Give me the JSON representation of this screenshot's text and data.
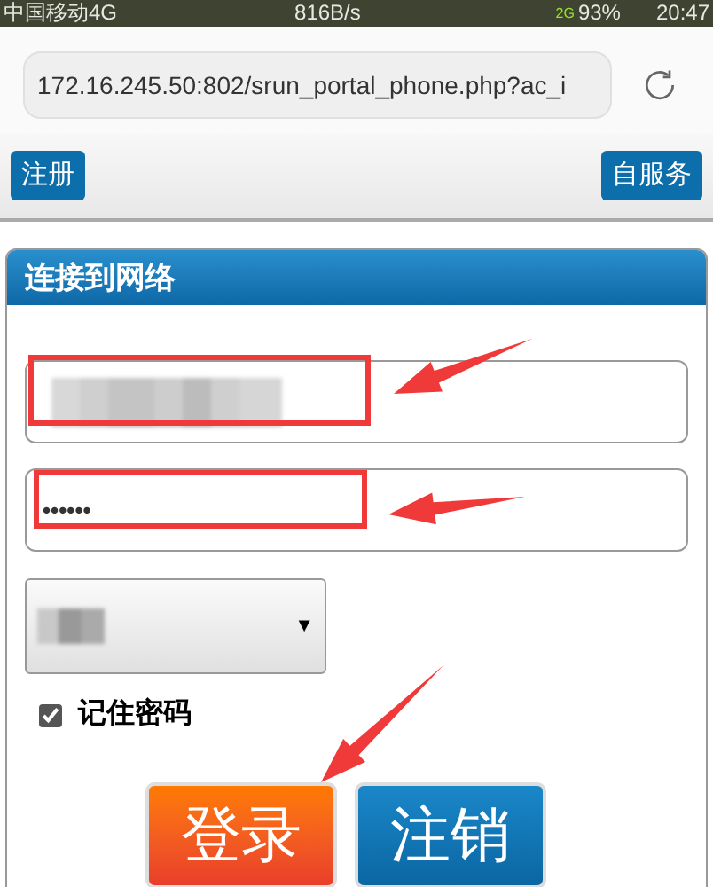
{
  "status_bar": {
    "carrier": "中国移动4G",
    "speed": "816B/s",
    "network": "2G",
    "battery": "93%",
    "time": "20:47"
  },
  "address_bar": {
    "url": "172.16.245.50:802/srun_portal_phone.php?ac_i"
  },
  "toolbar": {
    "buttons": [
      "注册",
      "自服务"
    ]
  },
  "panel": {
    "title": "连接到网络",
    "username": {
      "redacted": true
    },
    "password": {
      "value": "••••••"
    },
    "select": {
      "redacted": true,
      "caret": "▼"
    },
    "remember": {
      "label": "记住密码",
      "checked": true
    },
    "buttons": [
      {
        "label": "登录",
        "kind": "primary"
      },
      {
        "label": "注销",
        "kind": "secondary"
      }
    ]
  },
  "annotations": [
    {
      "kind": "box"
    },
    {
      "kind": "box"
    },
    {
      "kind": "arrow"
    },
    {
      "kind": "arrow"
    },
    {
      "kind": "arrow"
    }
  ]
}
